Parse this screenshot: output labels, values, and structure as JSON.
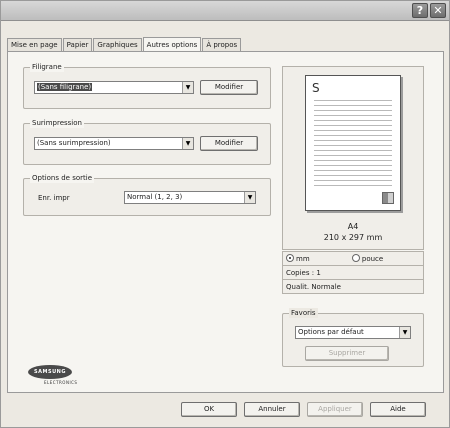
{
  "titlebar": {
    "help_icon": "?",
    "close_icon": "✕"
  },
  "tabs": [
    {
      "label": "Mise en page"
    },
    {
      "label": "Papier"
    },
    {
      "label": "Graphiques"
    },
    {
      "label": "Autres options"
    },
    {
      "label": "À propos"
    }
  ],
  "filigrane": {
    "label": "Filigrane",
    "value": "(Sans filigrane)",
    "modify": "Modifier"
  },
  "surimpression": {
    "label": "Surimpression",
    "value": "(Sans surimpression)",
    "modify": "Modifier"
  },
  "options_sortie": {
    "label": "Options de sortie",
    "field_label": "Enr. impr",
    "value": "Normal (1, 2, 3)"
  },
  "preview": {
    "page_letter": "S",
    "paper": "A4",
    "size": "210 x 297 mm"
  },
  "units": {
    "mm": "mm",
    "inch": "pouce",
    "selected": "mm"
  },
  "info": {
    "copies": "Copies : 1",
    "quality": "Qualit. Normale"
  },
  "favoris": {
    "label": "Favoris",
    "value": "Options par défaut",
    "delete": "Supprimer"
  },
  "brand": {
    "name": "SAMSUNG",
    "sub": "ELECTRONICS"
  },
  "buttons": {
    "ok": "OK",
    "cancel": "Annuler",
    "apply": "Appliquer",
    "help": "Aide"
  }
}
